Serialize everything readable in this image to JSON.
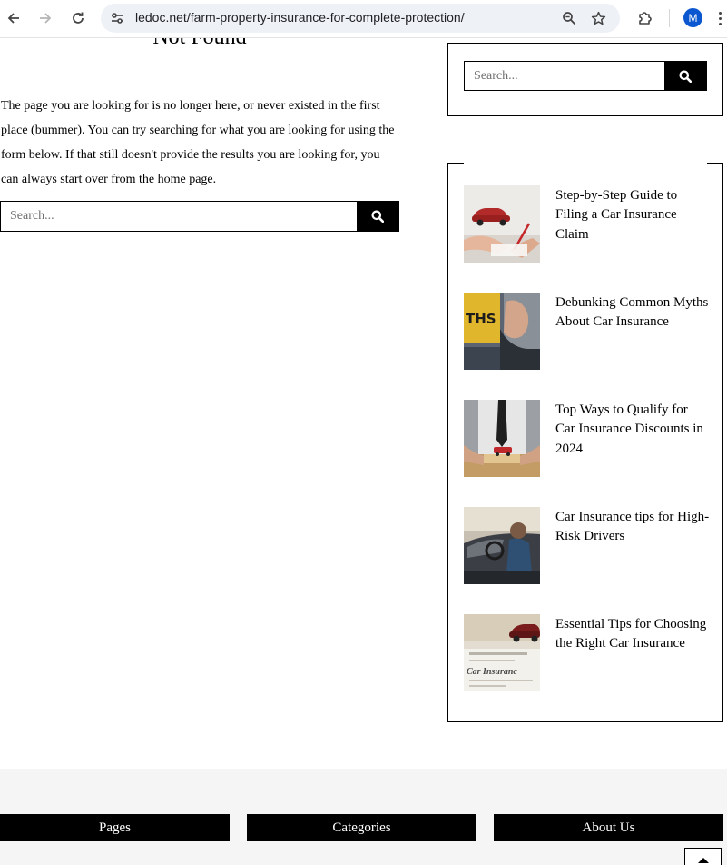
{
  "browser": {
    "url": "ledoc.net/farm-property-insurance-for-complete-protection/",
    "profile_initial": "M",
    "icons": {
      "back": "arrow-left-icon",
      "forward": "arrow-right-icon",
      "reload": "reload-icon",
      "site_info": "tune-icon",
      "zoom": "zoom-icon",
      "bookmark": "star-icon",
      "extensions": "puzzle-icon",
      "menu": "more-vert-icon"
    },
    "accent_color": "#0b57d0"
  },
  "main": {
    "title": "Not Found",
    "message": "The page you are looking for is no longer here, or never existed in the first place (bummer). You can try searching for what you are looking for using the form below. If that still doesn't provide the results you are looking for, you can always start over from the home page.",
    "search": {
      "placeholder": "Search..."
    }
  },
  "sidebar": {
    "search": {
      "placeholder": "Search..."
    },
    "posts": [
      {
        "title": "Step-by-Step Guide to Filing a Car Insurance Claim"
      },
      {
        "title": "Debunking Common Myths About Car Insurance"
      },
      {
        "title": "Top Ways to Qualify for Car Insurance Discounts in 2024"
      },
      {
        "title": "Car Insurance tips for High-Risk Drivers"
      },
      {
        "title": "Essential Tips for Choosing the Right Car Insurance"
      }
    ],
    "thumb_texts": {
      "sign": "THS",
      "form": "Car Insuranc"
    }
  },
  "footer": {
    "tabs": [
      "Pages",
      "Categories",
      "About Us"
    ],
    "back_to_top_icon": "chevron-up-icon"
  }
}
